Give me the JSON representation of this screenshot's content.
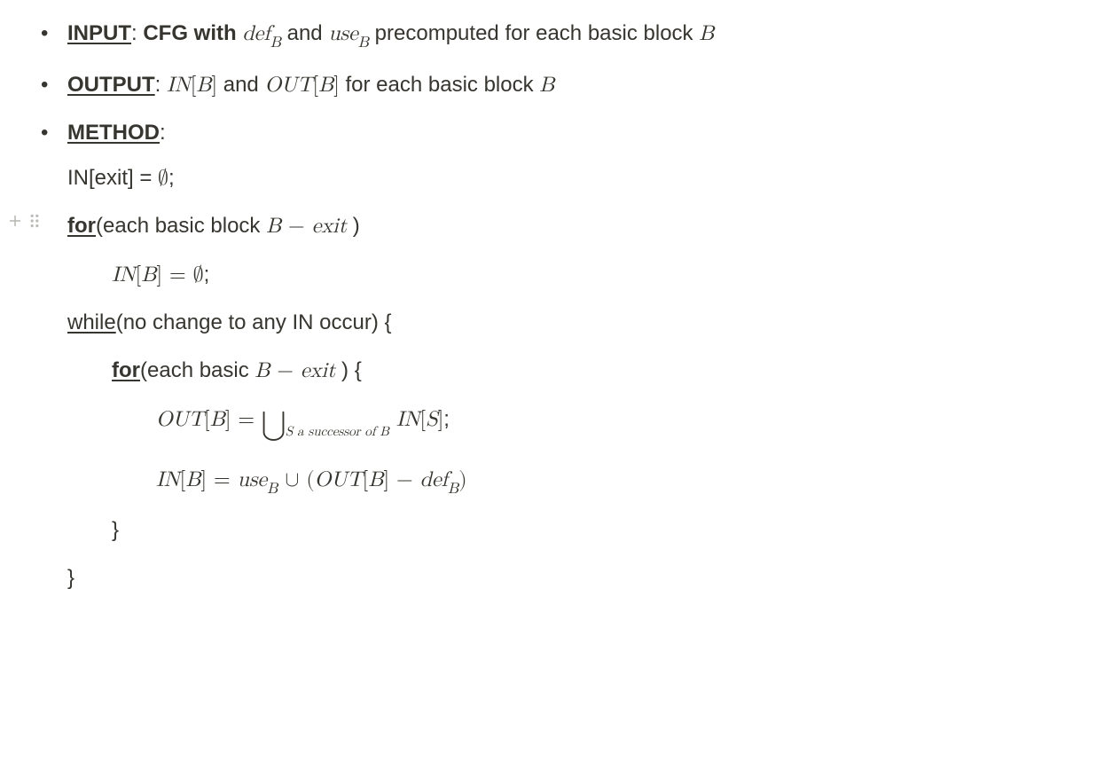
{
  "input": {
    "label": "INPUT",
    "prefix": "CFG with ",
    "def": "def",
    "defsub": "B",
    "and": " and ",
    "use": "use",
    "usesub": "B",
    "tail": " precomputed for each basic block ",
    "tailvar": "B"
  },
  "output": {
    "label": "OUTPUT",
    "in": "IN",
    "lbr": "[",
    "bv": "B",
    "rbr": "]",
    "and": " and ",
    "out": "OUT",
    "tail": " for each basic block ",
    "tailvar": "B"
  },
  "method": {
    "label": "METHOD",
    "line1": {
      "a": "IN[exit] = ",
      "empty": "∅",
      "semi": ";"
    },
    "for1": {
      "kw": "for",
      "a": "(each basic block ",
      "expr_B": "B",
      "expr_minus": " − ",
      "expr_exit": "exit",
      "close": " )"
    },
    "for1body": {
      "in": "IN",
      "lbr": "[",
      "b": "B",
      "rbr": "]",
      "eq": " = ",
      "empty": "∅",
      "semi": ";"
    },
    "while": {
      "kw": "while",
      "cond": "(no change to any IN occur) {"
    },
    "for2": {
      "kw": "for",
      "a": "(each basic ",
      "expr_B": "B",
      "expr_minus": " − ",
      "expr_exit": "exit",
      "close": " ) {"
    },
    "eq1": {
      "out": "OUT",
      "lbr": "[",
      "b": "B",
      "rbr": "]",
      "eq": " = ",
      "union": "⋃",
      "subtxt": "S a successor of B",
      "sp": " ",
      "in": "IN",
      "lbr2": "[",
      "s": "S",
      "rbr2": "]",
      "semi": ";"
    },
    "eq2": {
      "in": "IN",
      "lbr": "[",
      "b": "B",
      "rbr": "]",
      "eq": " = ",
      "use": "use",
      "usesub": "B",
      "cup": " ∪ ",
      "lp": "(",
      "out": "OUT",
      "lbr2": "[",
      "b2": "B",
      "rbr2": "]",
      "minus": " − ",
      "def": "def",
      "defsub": "B",
      "rp": ")"
    },
    "close2": "}",
    "close1": "}"
  }
}
